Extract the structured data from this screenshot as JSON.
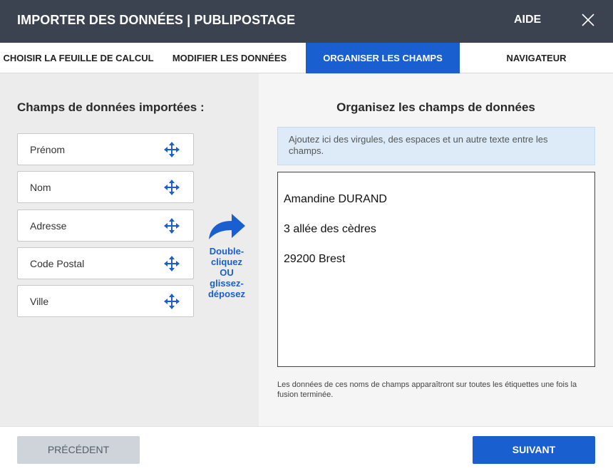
{
  "header": {
    "title": "IMPORTER DES DONNÉES | PUBLIPOSTAGE",
    "help_label": "AIDE",
    "close_icon": "close-icon"
  },
  "tabs": [
    {
      "label": "CHOISIR LA FEUILLE DE CALCUL",
      "active": false
    },
    {
      "label": "MODIFIER LES DONNÉES",
      "active": false
    },
    {
      "label": "ORGANISER LES CHAMPS",
      "active": true
    },
    {
      "label": "NAVIGATEUR",
      "active": false
    }
  ],
  "left_panel": {
    "heading": "Champs de données importées :",
    "fields": [
      {
        "label": "Prénom"
      },
      {
        "label": "Nom"
      },
      {
        "label": "Adresse"
      },
      {
        "label": "Code Postal"
      },
      {
        "label": "Ville"
      }
    ],
    "hint_lines": [
      "Double-",
      "cliquez",
      "OU",
      "glissez-",
      "déposez"
    ]
  },
  "right_panel": {
    "heading": "Organisez les champs de données",
    "info_text": "Ajoutez ici des virgules, des espaces et un autre texte entre les champs.",
    "editor_lines": [
      "Amandine DURAND",
      "3 allée des cèdres",
      "29200 Brest"
    ],
    "note": "Les données de ces noms de champs apparaîtront sur toutes les étiquettes une fois la fusion terminée."
  },
  "footer": {
    "prev_label": "PRÉCÉDENT",
    "next_label": "SUIVANT"
  },
  "colors": {
    "header_bg": "#3b4350",
    "accent": "#1a5fd0",
    "left_bg": "#ececec",
    "right_bg": "#f5f5f5",
    "info_bg": "#dcebf7"
  }
}
